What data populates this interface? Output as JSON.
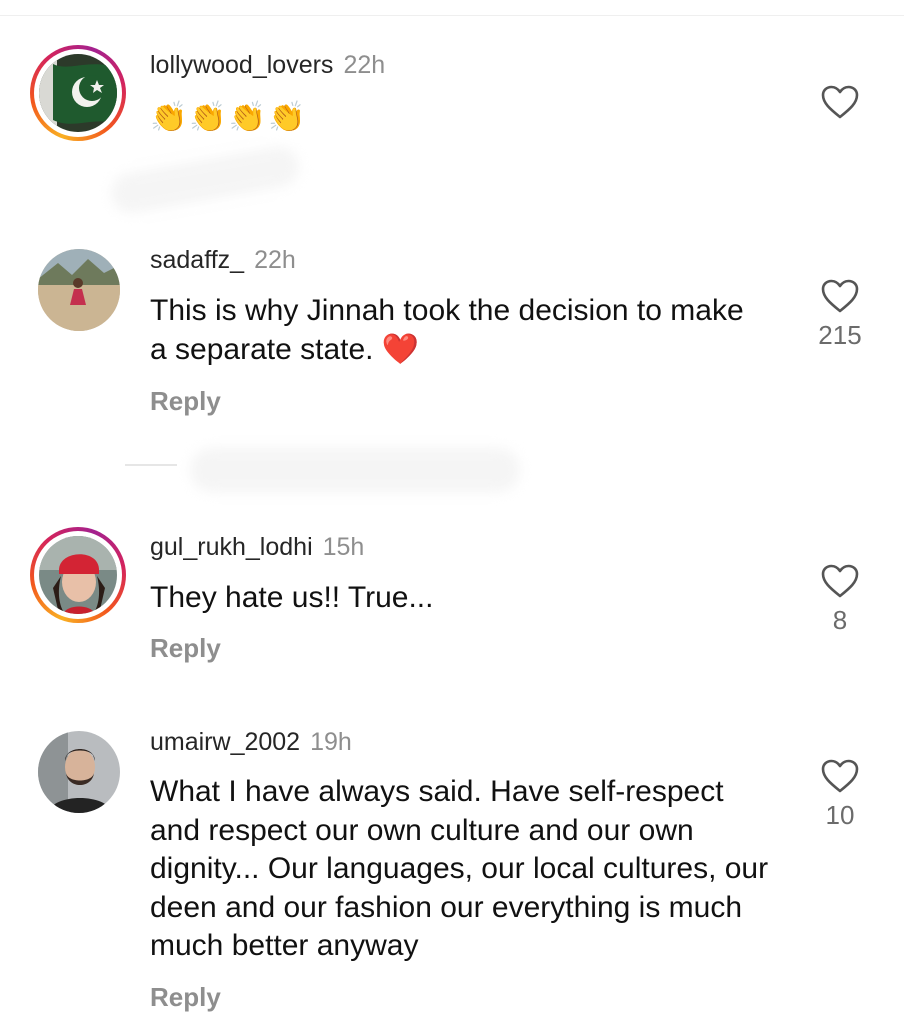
{
  "comments": [
    {
      "username": "lollywood_lovers",
      "time": "22h",
      "text": "👏👏👏👏",
      "likes": "",
      "reply": "",
      "avatar": "pakistan-flag"
    },
    {
      "username": "sadaffz_",
      "time": "22h",
      "text": "This is why Jinnah took the decision to make a separate state. ❤️",
      "likes": "215",
      "reply": "Reply",
      "avatar": "person-outdoors"
    },
    {
      "username": "gul_rukh_lodhi",
      "time": "15h",
      "text": "They hate us!! True...",
      "likes": "8",
      "reply": "Reply",
      "avatar": "woman-red-beanie"
    },
    {
      "username": "umairw_2002",
      "time": "19h",
      "text": "What I have always said. Have self-respect and respect our own culture and our own dignity... Our languages, our local cultures, our deen and our fashion our everything is much much better anyway",
      "likes": "10",
      "reply": "Reply",
      "avatar": "man-portrait"
    }
  ],
  "icons": {
    "like": "heart-outline-icon"
  },
  "colors": {
    "username": "#262626",
    "muted": "#8e8e8e",
    "story_ring_start": "#f9b023",
    "story_ring_end": "#a3218f",
    "heart_emoji": "#e0245e"
  }
}
